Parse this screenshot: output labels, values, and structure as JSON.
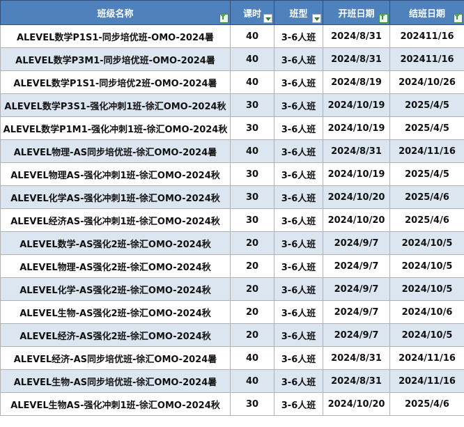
{
  "headers": [
    "班级名称",
    "课时",
    "班型",
    "开班日期",
    "结班日期"
  ],
  "rows": [
    [
      "ALEVEL数学P1S1-同步培优班-OMO-2024暑",
      "40",
      "3-6人班",
      "2024/8/31",
      "202411/16"
    ],
    [
      "ALEVEL数学P3M1-同步培优班-OMO-2024暑",
      "40",
      "3-6人班",
      "2024/8/31",
      "202411/16"
    ],
    [
      "ALEVEL数学P1S1-同步培优2班-OMO-2024暑",
      "40",
      "3-6人班",
      "2024/8/19",
      "2024/10/26"
    ],
    [
      "ALEVEL数学P3S1-强化冲刺1班-徐汇OMO-2024秋",
      "30",
      "3-6人班",
      "2024/10/19",
      "2025/4/5"
    ],
    [
      "ALEVEL数学P1M1-强化冲刺1班-徐汇OMO-2024秋",
      "30",
      "3-6人班",
      "2024/10/19",
      "2025/4/5"
    ],
    [
      "ALEVEL物理-AS同步培优班-徐汇OMO-2024暑",
      "40",
      "3-6人班",
      "2024/8/31",
      "2024/11/16"
    ],
    [
      "ALEVEL物理AS-强化冲刺1班-徐汇OMO-2024秋",
      "30",
      "3-6人班",
      "2024/10/19",
      "2025/4/5"
    ],
    [
      "ALEVEL化学AS-强化冲刺1班-徐汇OMO-2024秋",
      "30",
      "3-6人班",
      "2024/10/20",
      "2025/4/6"
    ],
    [
      "ALEVEL经济AS-强化冲刺1班-徐汇OMO-2024秋",
      "30",
      "3-6人班",
      "2024/10/20",
      "2025/4/6"
    ],
    [
      "ALEVEL数学-AS强化2班-徐汇OMO-2024秋",
      "20",
      "3-6人班",
      "2024/9/7",
      "2024/10/5"
    ],
    [
      "ALEVEL物理-AS强化2班-徐汇OMO-2024秋",
      "20",
      "3-6人班",
      "2024/9/7",
      "2024/10/5"
    ],
    [
      "ALEVEL化学-AS强化2班-徐汇OMO-2024秋",
      "20",
      "3-6人班",
      "2024/9/7",
      "2024/10/5"
    ],
    [
      "ALEVEL生物-AS强化2班-徐汇OMO-2024秋",
      "20",
      "3-6人班",
      "2024/9/7",
      "2024/10/6"
    ],
    [
      "ALEVEL经济-AS强化2班-徐汇OMO-2024秋",
      "20",
      "3-6人班",
      "2024/9/7",
      "2024/10/5"
    ],
    [
      "ALEVEL经济-AS同步培优班-徐汇OMO-2024暑",
      "40",
      "3-6人班",
      "2024/8/31",
      "2024/11/16"
    ],
    [
      "ALEVEL生物-AS同步培优班-徐汇OMO-2024暑",
      "40",
      "3-6人班",
      "2024/8/31",
      "2024/11/16"
    ],
    [
      "ALEVEL生物AS-强化冲刺1班-徐汇OMO-2024秋",
      "30",
      "3-6人班",
      "2024/10/20",
      "2025/4/6"
    ]
  ],
  "filters": [
    "active",
    "dropdown",
    "dropdown",
    "active",
    "active"
  ],
  "colors": {
    "header_bg": "#4f81bd",
    "alt_row_bg": "#dce6f1",
    "filter_icon": "#2e7d32"
  }
}
